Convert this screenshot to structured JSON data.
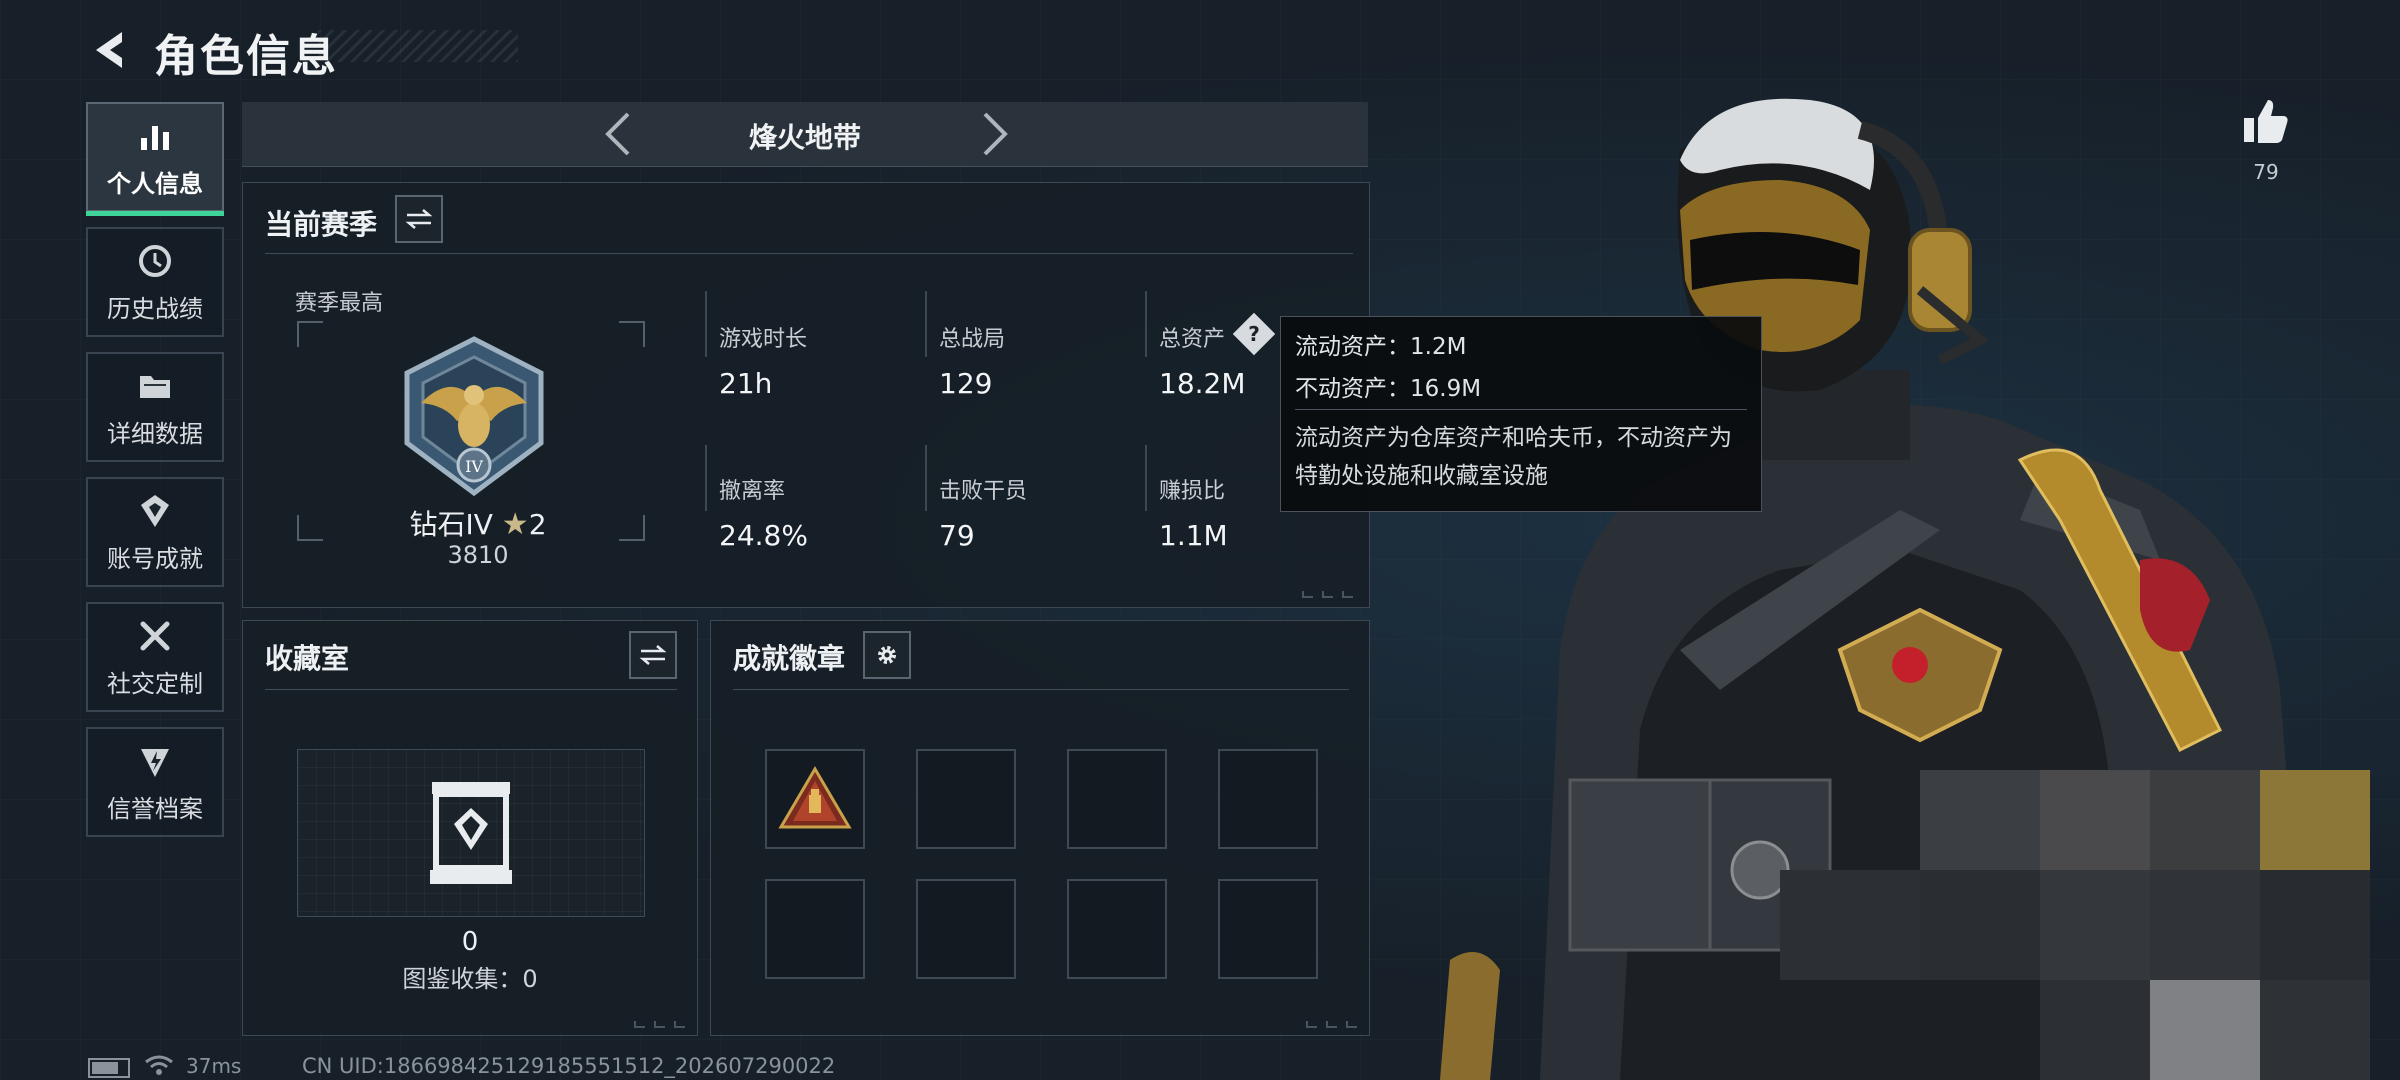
{
  "header": {
    "title": "角色信息",
    "back_icon": "chevron-left-icon"
  },
  "sidebar": {
    "items": [
      {
        "label": "个人信息",
        "icon": "bar-chart-icon",
        "active": true
      },
      {
        "label": "历史战绩",
        "icon": "history-icon",
        "active": false
      },
      {
        "label": "详细数据",
        "icon": "folder-icon",
        "active": false
      },
      {
        "label": "账号成就",
        "icon": "achievement-icon",
        "active": false
      },
      {
        "label": "社交定制",
        "icon": "tools-icon",
        "active": false
      },
      {
        "label": "信誉档案",
        "icon": "credit-icon",
        "active": false
      }
    ]
  },
  "mode": {
    "title": "烽火地带"
  },
  "season": {
    "title": "当前赛季",
    "peak_label": "赛季最高",
    "rank_name": "钻石IV",
    "rank_stars": "2",
    "rank_score": "3810",
    "stats": [
      {
        "label": "游戏时长",
        "value": "21h"
      },
      {
        "label": "总战局",
        "value": "129"
      },
      {
        "label": "总资产",
        "value": "18.2M"
      },
      {
        "label": "撤离率",
        "value": "24.8%"
      },
      {
        "label": "击败干员",
        "value": "79"
      },
      {
        "label": "赚损比",
        "value": "1.1M"
      }
    ]
  },
  "tooltip": {
    "line1": "流动资产：1.2M",
    "line2": "不动资产：16.9M",
    "desc": "流动资产为仓库资产和哈夫币，不动资产为特勤处设施和收藏室设施"
  },
  "collection": {
    "title": "收藏室",
    "count": "0",
    "catalog": "图鉴收集：0"
  },
  "badges": {
    "title": "成就徽章",
    "slot_count": 8
  },
  "likes": {
    "count": "79"
  },
  "status": {
    "ping": "37ms",
    "uid": "CN UID:18669842512918555151​2_202607290022"
  },
  "colors": {
    "accent": "#3fd49a",
    "background": "#172029",
    "gold": "#c9a14a"
  }
}
